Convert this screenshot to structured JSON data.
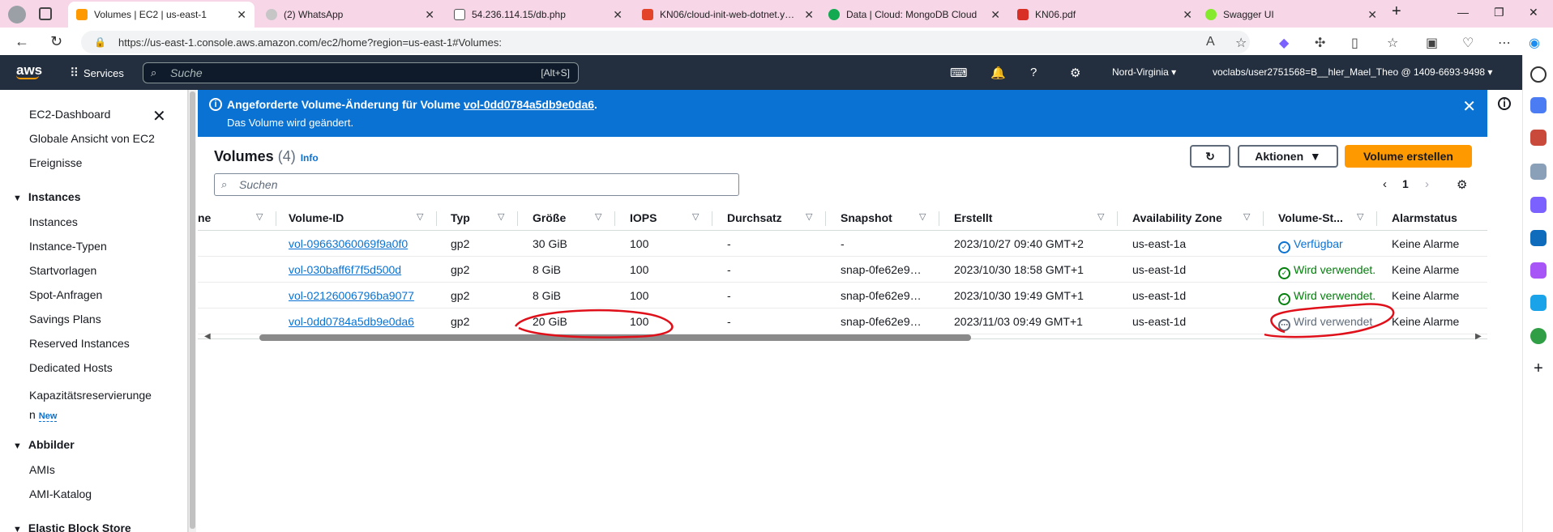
{
  "browser": {
    "tabs": [
      {
        "title": "Volumes | EC2 | us-east-1",
        "color": "#ff9900",
        "active": true
      },
      {
        "title": "(2) WhatsApp",
        "color": "#c6c6c6",
        "active": false
      },
      {
        "title": "54.236.114.15/db.php",
        "color": "#ffffff",
        "active": false
      },
      {
        "title": "KN06/cloud-init-web-dotnet.yaml",
        "color": "#e24329",
        "active": false
      },
      {
        "title": "Data | Cloud: MongoDB Cloud",
        "color": "#13aa52",
        "active": false
      },
      {
        "title": "KN06.pdf",
        "color": "#d93025",
        "active": false
      },
      {
        "title": "Swagger UI",
        "color": "#85ea2d",
        "active": false
      }
    ],
    "url": "https://us-east-1.console.aws.amazon.com/ec2/home?region=us-east-1#Volumes:"
  },
  "aws_header": {
    "logo": "aws",
    "services_label": "Services",
    "search_placeholder": "Suche",
    "search_shortcut": "[Alt+S]",
    "region": "Nord-Virginia",
    "account": "voclabs/user2751568=B__hler_Mael_Theo @ 1409-6693-9498"
  },
  "sidenav": {
    "top_items": [
      "EC2-Dashboard",
      "Globale Ansicht von EC2",
      "Ereignisse"
    ],
    "sections": [
      {
        "title": "Instances",
        "items": [
          "Instances",
          "Instance-Typen",
          "Startvorlagen",
          "Spot-Anfragen",
          "Savings Plans",
          "Reserved Instances",
          "Dedicated Hosts",
          "Kapazitätsreservierunge",
          "n"
        ]
      },
      {
        "title": "Abbilder",
        "items": [
          "AMIs",
          "AMI-Katalog"
        ]
      },
      {
        "title": "Elastic Block Store",
        "items": []
      }
    ],
    "new_badge": "New"
  },
  "flash": {
    "heading": "Angeforderte Volume-Änderung für Volume",
    "volume_link": "vol-0dd0784a5db9e0da6",
    "heading_end": ".",
    "message": "Das Volume wird geändert."
  },
  "panel": {
    "title": "Volumes",
    "count": "(4)",
    "info": "Info",
    "actions_label": "Aktionen",
    "create_label": "Volume erstellen",
    "search_placeholder": "Suchen",
    "page": "1"
  },
  "table": {
    "columns": [
      "ne",
      "Volume-ID",
      "Typ",
      "Größe",
      "IOPS",
      "Durchsatz",
      "Snapshot",
      "Erstellt",
      "Availability Zone",
      "Volume-St...",
      "Alarmstatus"
    ],
    "rows": [
      {
        "id": "vol-09663060069f9a0f0",
        "type": "gp2",
        "size": "30 GiB",
        "iops": "100",
        "throughput": "-",
        "snapshot": "-",
        "created": "2023/10/27 09:40 GMT+2",
        "az": "us-east-1a",
        "state": "Verfügbar",
        "state_kind": "blue",
        "alarm": "Keine Alarme"
      },
      {
        "id": "vol-030baff6f7f5d500d",
        "type": "gp2",
        "size": "8 GiB",
        "iops": "100",
        "throughput": "-",
        "snapshot": "snap-0fe62e9…",
        "created": "2023/10/30 18:58 GMT+1",
        "az": "us-east-1d",
        "state": "Wird verwendet.",
        "state_kind": "green",
        "alarm": "Keine Alarme"
      },
      {
        "id": "vol-02126006796ba9077",
        "type": "gp2",
        "size": "8 GiB",
        "iops": "100",
        "throughput": "-",
        "snapshot": "snap-0fe62e9…",
        "created": "2023/10/30 19:49 GMT+1",
        "az": "us-east-1d",
        "state": "Wird verwendet.",
        "state_kind": "green",
        "alarm": "Keine Alarme"
      },
      {
        "id": "vol-0dd0784a5db9e0da6",
        "type": "gp2",
        "size": "20 GiB",
        "iops": "100",
        "throughput": "-",
        "snapshot": "snap-0fe62e9…",
        "created": "2023/11/03 09:49 GMT+1",
        "az": "us-east-1d",
        "state": "Wird verwendet",
        "state_kind": "grey",
        "alarm": "Keine Alarme"
      }
    ]
  },
  "colors": {
    "aws_header": "#232f3e",
    "flash": "#0972d3",
    "primary_button": "#ff9900",
    "link": "#0972d3",
    "annotation": "#e0101a"
  }
}
